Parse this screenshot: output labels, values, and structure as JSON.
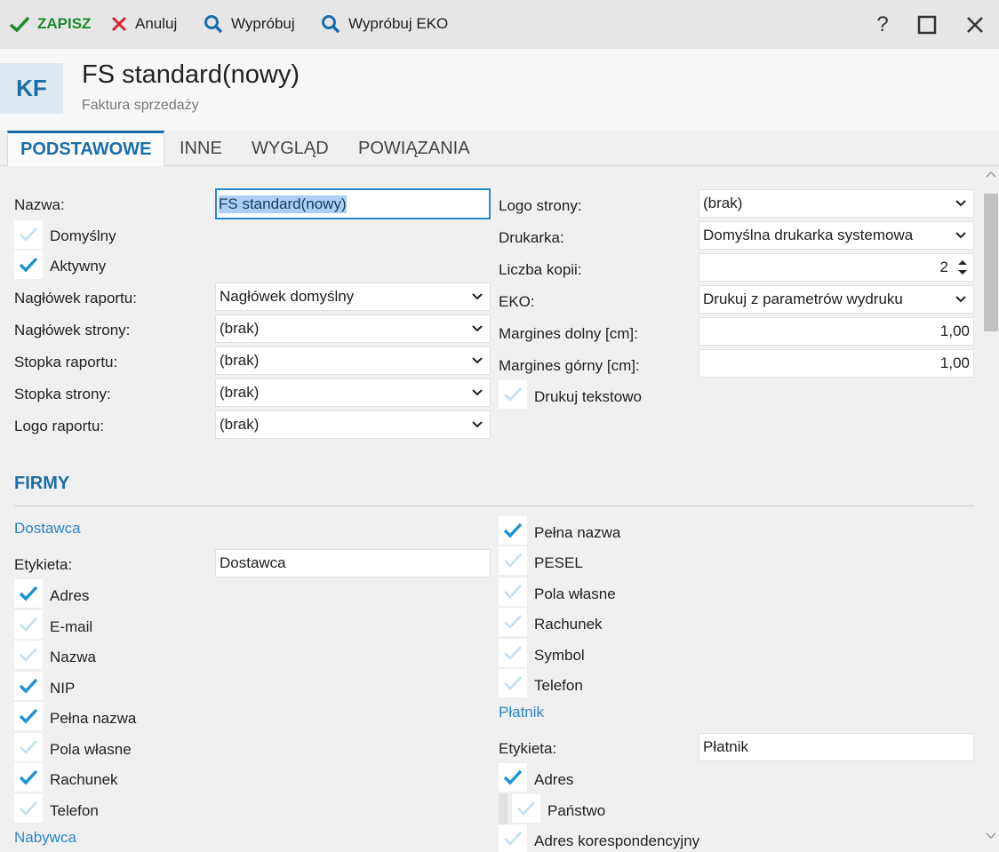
{
  "toolbar": {
    "save_label": "ZAPISZ",
    "cancel_label": "Anuluj",
    "try_label": "Wypróbuj",
    "try_eko_label": "Wypróbuj EKO",
    "help_label": "?"
  },
  "header": {
    "badge": "KF",
    "title": "FS standard(nowy)",
    "subtitle": "Faktura sprzedaży"
  },
  "tabs": [
    {
      "label": "PODSTAWOWE",
      "active": true
    },
    {
      "label": "INNE",
      "active": false
    },
    {
      "label": "WYGLĄD",
      "active": false
    },
    {
      "label": "POWIĄZANIA",
      "active": false
    }
  ],
  "form_left": {
    "name_label": "Nazwa:",
    "name_value": "FS standard(nowy)",
    "default_label": "Domyślny",
    "default_checked": false,
    "active_label": "Aktywny",
    "active_checked": true,
    "report_header_label": "Nagłówek raportu:",
    "report_header_value": "Nagłówek domyślny",
    "page_header_label": "Nagłówek strony:",
    "page_header_value": "(brak)",
    "report_footer_label": "Stopka raportu:",
    "report_footer_value": "(brak)",
    "page_footer_label": "Stopka strony:",
    "page_footer_value": "(brak)",
    "report_logo_label": "Logo raportu:",
    "report_logo_value": "(brak)"
  },
  "form_right": {
    "page_logo_label": "Logo strony:",
    "page_logo_value": "(brak)",
    "printer_label": "Drukarka:",
    "printer_value": "Domyślna drukarka systemowa",
    "copies_label": "Liczba kopii:",
    "copies_value": "2",
    "eko_label": "EKO:",
    "eko_value": "Drukuj z parametrów wydruku",
    "margin_bottom_label": "Margines dolny [cm]:",
    "margin_bottom_value": "1,00",
    "margin_top_label": "Margines górny [cm]:",
    "margin_top_value": "1,00",
    "print_text_label": "Drukuj tekstowo",
    "print_text_checked": false
  },
  "firms": {
    "section_title": "FIRMY",
    "supplier": {
      "group_title": "Dostawca",
      "label_label": "Etykieta:",
      "label_value": "Dostawca",
      "checks": [
        {
          "label": "Adres",
          "checked": true
        },
        {
          "label": "E-mail",
          "checked": false
        },
        {
          "label": "Nazwa",
          "checked": false
        },
        {
          "label": "NIP",
          "checked": true
        },
        {
          "label": "Pełna nazwa",
          "checked": true
        },
        {
          "label": "Pola własne",
          "checked": false
        },
        {
          "label": "Rachunek",
          "checked": true
        },
        {
          "label": "Telefon",
          "checked": false
        }
      ]
    },
    "buyer": {
      "group_title": "Nabywca",
      "checks": [
        {
          "label": "Pełna nazwa",
          "checked": true
        },
        {
          "label": "PESEL",
          "checked": false
        },
        {
          "label": "Pola własne",
          "checked": false
        },
        {
          "label": "Rachunek",
          "checked": false
        },
        {
          "label": "Symbol",
          "checked": false
        },
        {
          "label": "Telefon",
          "checked": false
        }
      ]
    },
    "payer": {
      "group_title": "Płatnik",
      "label_label": "Etykieta:",
      "label_value": "Płatnik",
      "checks": [
        {
          "label": "Adres",
          "checked": true
        },
        {
          "label": "Państwo",
          "checked": false
        },
        {
          "label": "Adres korespondencyjny",
          "checked": false
        }
      ]
    }
  },
  "colors": {
    "accent": "#1a6fa8",
    "check_on": "#1f93d4",
    "check_off": "#c3dff0",
    "save_green": "#1e8a2e",
    "cancel_red": "#d6262c"
  }
}
